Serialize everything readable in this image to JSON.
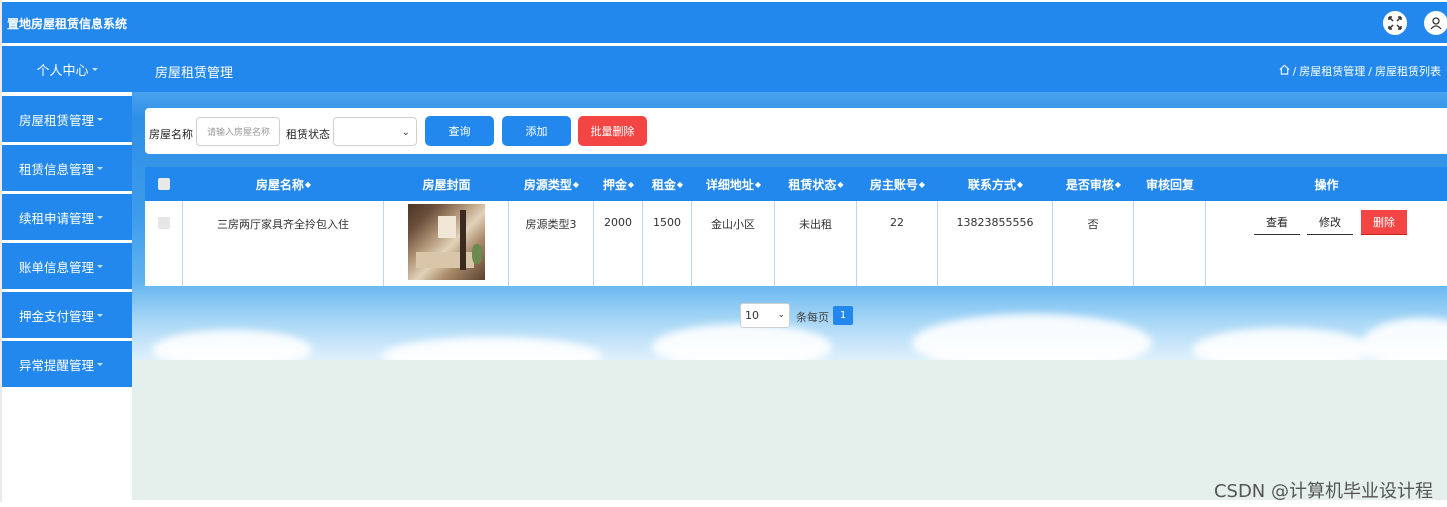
{
  "app": {
    "title": "置地房屋租赁信息系统"
  },
  "topbar": {
    "fullscreen_icon": "fullscreen-icon",
    "user_icon": "user-icon"
  },
  "nav": {
    "personal_center": "个人中心",
    "section_title": "房屋租赁管理",
    "breadcrumb": {
      "home_icon": "home-icon",
      "sep": "/",
      "level1": "房屋租赁管理",
      "level2": "房屋租赁列表"
    }
  },
  "sidebar": {
    "items": [
      {
        "label": "房屋租赁管理"
      },
      {
        "label": "租赁信息管理"
      },
      {
        "label": "续租申请管理"
      },
      {
        "label": "账单信息管理"
      },
      {
        "label": "押金支付管理"
      },
      {
        "label": "异常提醒管理"
      }
    ]
  },
  "search": {
    "name_label": "房屋名称",
    "name_placeholder": "请输入房屋名称",
    "status_label": "租赁状态",
    "status_value": "",
    "query_button": "查询",
    "add_button": "添加",
    "batch_delete_button": "批量删除"
  },
  "table": {
    "headers": {
      "name": "房屋名称",
      "cover": "房屋封面",
      "type": "房源类型",
      "deposit": "押金",
      "rent": "租金",
      "address": "详细地址",
      "status": "租赁状态",
      "owner": "房主账号",
      "contact": "联系方式",
      "audited": "是否审核",
      "reply": "审核回复",
      "actions": "操作"
    },
    "sort_icon": "◆",
    "rows": [
      {
        "name": "三房两厅家具齐全拎包入住",
        "cover": "house-photo",
        "type": "房源类型3",
        "deposit": "2000",
        "rent": "1500",
        "address": "金山小区",
        "status": "未出租",
        "owner": "22",
        "contact": "13823855556",
        "audited": "否",
        "reply": "",
        "view": "查看",
        "edit": "修改",
        "delete": "删除"
      }
    ]
  },
  "pagination": {
    "page_size": "10",
    "per_page_label": "条每页",
    "current_page": "1"
  },
  "watermark": "CSDN @计算机毕业设计程",
  "colors": {
    "primary": "#2288ee",
    "danger": "#f44545",
    "sky_bottom": "#e5efec"
  }
}
